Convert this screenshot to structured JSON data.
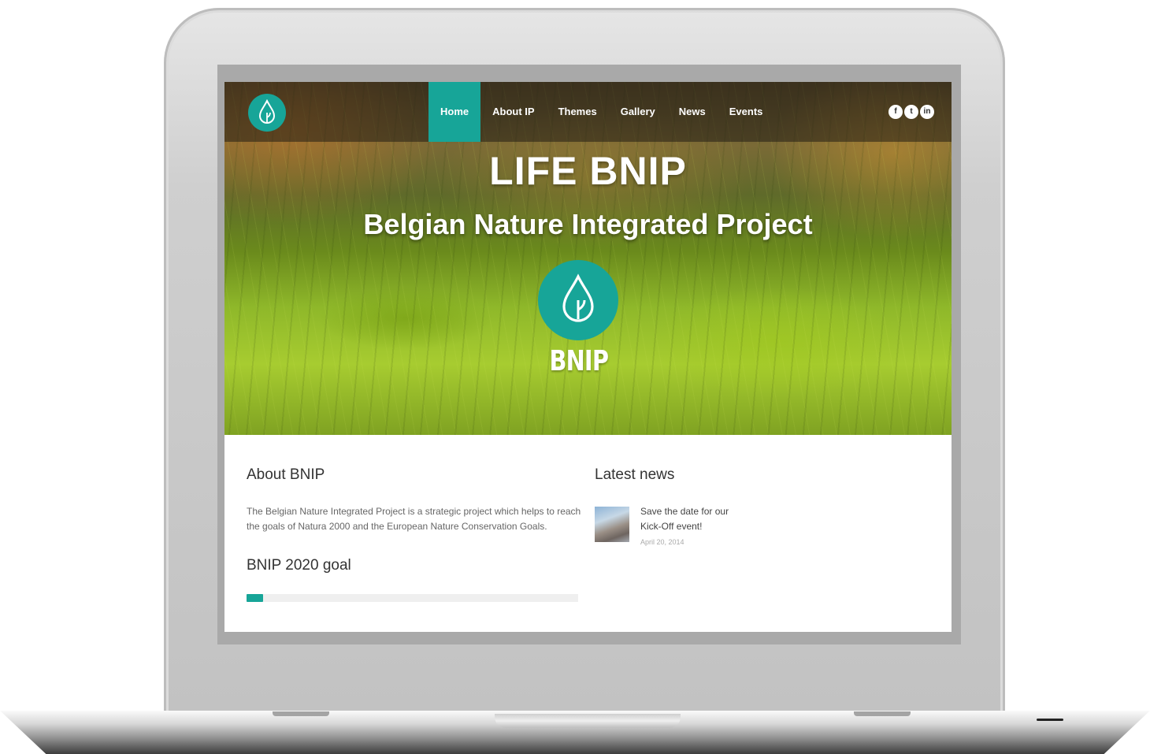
{
  "nav": {
    "items": [
      {
        "label": "Home",
        "active": true
      },
      {
        "label": "About IP",
        "active": false
      },
      {
        "label": "Themes",
        "active": false
      },
      {
        "label": "Gallery",
        "active": false
      },
      {
        "label": "News",
        "active": false
      },
      {
        "label": "Events",
        "active": false
      }
    ],
    "social": [
      {
        "icon": "facebook-icon",
        "glyph": "f"
      },
      {
        "icon": "twitter-icon",
        "glyph": "t"
      },
      {
        "icon": "linkedin-icon",
        "glyph": "in"
      }
    ]
  },
  "hero": {
    "title": "LIFE BNIP",
    "subtitle": "Belgian Nature Integrated Project",
    "logo_text": "BNIP",
    "logo_icon": "water-drop-leaf-icon"
  },
  "about": {
    "title": "About BNIP",
    "text": "The Belgian Nature Integrated Project is a strategic project which helps to reach the goals of Natura 2000 and the European Nature Conservation Goals."
  },
  "goal": {
    "title": "BNIP 2020 goal",
    "progress": 0.05
  },
  "news": {
    "title": "Latest news",
    "items": [
      {
        "title": "Save the date for our Kick-Off event!",
        "date": "April 20, 2014"
      }
    ]
  },
  "colors": {
    "accent": "#17a598",
    "heading": "#333333",
    "body_text": "#666666"
  }
}
